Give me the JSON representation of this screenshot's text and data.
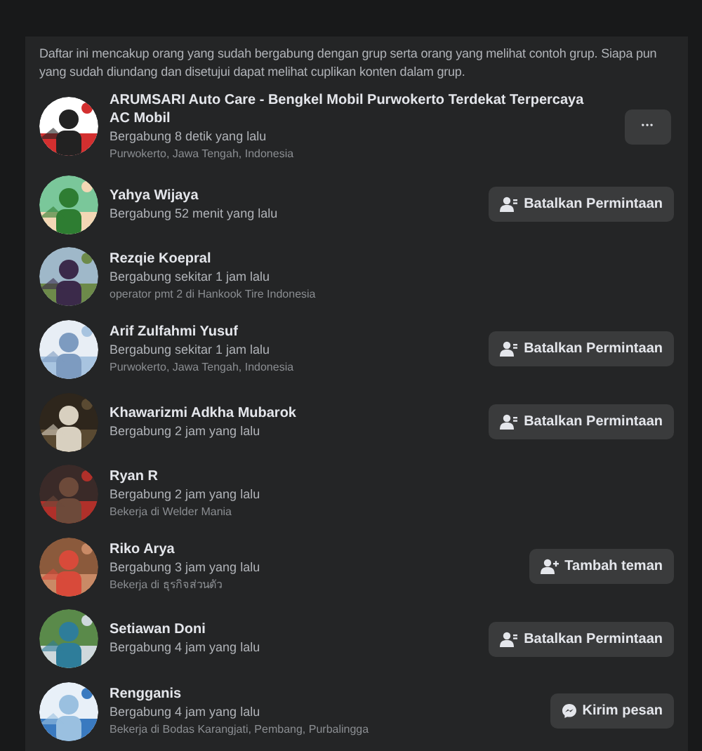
{
  "intro": "Daftar ini mencakup orang yang sudah bergabung dengan grup serta orang yang melihat contoh grup. Siapa pun yang sudah diundang dan disetujui dapat melihat cuplikan konten dalam grup.",
  "members": [
    {
      "name": "ARUMSARI Auto Care - Bengkel Mobil Purwokerto Terdekat Terpercaya AC Mobil",
      "joined": "Bergabung 8 detik yang lalu",
      "detail": "Purwokerto, Jawa Tengah, Indonesia",
      "action": {
        "kind": "more",
        "label": "•••"
      }
    },
    {
      "name": "Yahya Wijaya",
      "joined": "Bergabung 52 menit yang lalu",
      "action": {
        "kind": "cancel",
        "label": "Batalkan Permintaan"
      }
    },
    {
      "name": "Rezqie Koepral",
      "joined": "Bergabung sekitar 1 jam lalu",
      "detail": "operator pmt 2 di Hankook Tire Indonesia"
    },
    {
      "name": "Arif Zulfahmi Yusuf",
      "joined": "Bergabung sekitar 1 jam lalu",
      "detail": "Purwokerto, Jawa Tengah, Indonesia",
      "action": {
        "kind": "cancel",
        "label": "Batalkan Permintaan"
      }
    },
    {
      "name": "Khawarizmi Adkha Mubarok",
      "joined": "Bergabung 2 jam yang lalu",
      "action": {
        "kind": "cancel",
        "label": "Batalkan Permintaan"
      }
    },
    {
      "name": "Ryan R",
      "joined": "Bergabung 2 jam yang lalu",
      "detail": "Bekerja di Welder Mania"
    },
    {
      "name": "Riko Arya",
      "joined": "Bergabung 3 jam yang lalu",
      "detail": "Bekerja di ธุรกิจส่วนตัว",
      "action": {
        "kind": "add",
        "label": "Tambah teman"
      }
    },
    {
      "name": "Setiawan Doni",
      "joined": "Bergabung 4 jam yang lalu",
      "action": {
        "kind": "cancel",
        "label": "Batalkan Permintaan"
      }
    },
    {
      "name": "Rengganis",
      "joined": "Bergabung 4 jam yang lalu",
      "detail": "Bekerja di Bodas Karangjati, Pembang, Purbalingga",
      "action": {
        "kind": "message",
        "label": "Kirim pesan"
      }
    }
  ]
}
